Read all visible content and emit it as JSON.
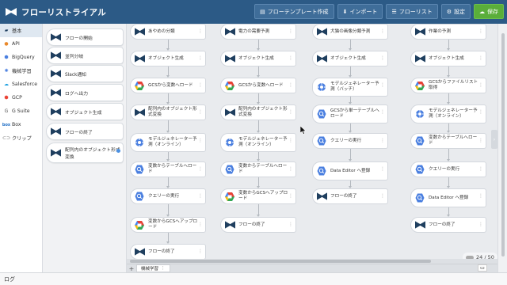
{
  "app": {
    "title": "フローリストライアル"
  },
  "toolbar": {
    "template": "フローテンプレート作成",
    "import": "インポート",
    "flowlist": "フローリスト",
    "settings": "設定",
    "save": "保存"
  },
  "categories": [
    {
      "label": "基本",
      "icon": "home-icon"
    },
    {
      "label": "API",
      "icon": "api-icon"
    },
    {
      "label": "BigQuery",
      "icon": "bigquery-icon"
    },
    {
      "label": "機械学習",
      "icon": "ml-icon"
    },
    {
      "label": "Salesforce",
      "icon": "salesforce-icon"
    },
    {
      "label": "GCP",
      "icon": "gcp-icon"
    },
    {
      "label": "G Suite",
      "icon": "gsuite-icon"
    },
    {
      "label": "Box",
      "icon": "box-icon"
    },
    {
      "label": "クリップ",
      "icon": "clip-icon"
    }
  ],
  "palette": [
    "フローの開始",
    "並列分岐",
    "Slack通知",
    "ログへ出力",
    "オブジェクト生成",
    "フローの終了",
    "配列内のオブジェクト形式変換"
  ],
  "canvas_columns": [
    [
      {
        "label": "あやめの分類",
        "icon": "flow-icon"
      },
      {
        "label": "オブジェクト生成",
        "icon": "flow-icon"
      },
      {
        "label": "GCSから変数へロード",
        "icon": "gcs-icon"
      },
      {
        "label": "配列内のオブジェクト形式変換",
        "icon": "flow-icon"
      },
      {
        "label": "モデルジェネレーター予測（オンライン）",
        "icon": "ml-icon"
      },
      {
        "label": "変数からテーブルへロード",
        "icon": "bq-icon"
      },
      {
        "label": "クエリーの実行",
        "icon": "bq-icon"
      },
      {
        "label": "変数からGCSへアップロード",
        "icon": "gcs-icon"
      },
      {
        "label": "フローの終了",
        "icon": "flow-icon"
      }
    ],
    [
      {
        "label": "電力の需要予測",
        "icon": "flow-icon"
      },
      {
        "label": "オブジェクト生成",
        "icon": "flow-icon"
      },
      {
        "label": "GCSから変数へロード",
        "icon": "gcs-icon"
      },
      {
        "label": "配列内のオブジェクト形式変換",
        "icon": "flow-icon"
      },
      {
        "label": "モデルジェネレーター予測（オンライン）",
        "icon": "ml-icon"
      },
      {
        "label": "変数からテーブルへロード",
        "icon": "bq-icon"
      },
      {
        "label": "変数からGCSへアップロード",
        "icon": "gcs-icon"
      },
      {
        "label": "フローの終了",
        "icon": "flow-icon"
      }
    ],
    [
      {
        "label": "犬猫の画像分類予測",
        "icon": "flow-icon"
      },
      {
        "label": "オブジェクト生成",
        "icon": "flow-icon"
      },
      {
        "label": "モデルジェネレーター予測（バッチ）",
        "icon": "ml-icon"
      },
      {
        "label": "GCSから単一テーブルへロード",
        "icon": "bq-icon"
      },
      {
        "label": "クエリーの実行",
        "icon": "bq-icon"
      },
      {
        "label": "Data Editor へ登録",
        "icon": "bq-icon"
      },
      {
        "label": "フローの終了",
        "icon": "flow-icon"
      }
    ],
    [
      {
        "label": "作業の予測",
        "icon": "flow-icon"
      },
      {
        "label": "オブジェクト生成",
        "icon": "flow-icon"
      },
      {
        "label": "GCSからファイルリスト取得",
        "icon": "gcs-icon"
      },
      {
        "label": "モデルジェネレーター予測（オンライン）",
        "icon": "ml-icon"
      },
      {
        "label": "変数からテーブルへロード",
        "icon": "bq-icon"
      },
      {
        "label": "クエリーの実行",
        "icon": "bq-icon"
      },
      {
        "label": "Data Editor へ登録",
        "icon": "bq-icon"
      },
      {
        "label": "フローの終了",
        "icon": "flow-icon"
      }
    ]
  ],
  "counter": "24 / 50",
  "tab": {
    "label": "機械学習"
  },
  "footer": {
    "label": "ログ"
  },
  "colors": {
    "header": "#2c5a86",
    "save": "#5aae3a",
    "flow_icon": "#1f3f5f"
  }
}
